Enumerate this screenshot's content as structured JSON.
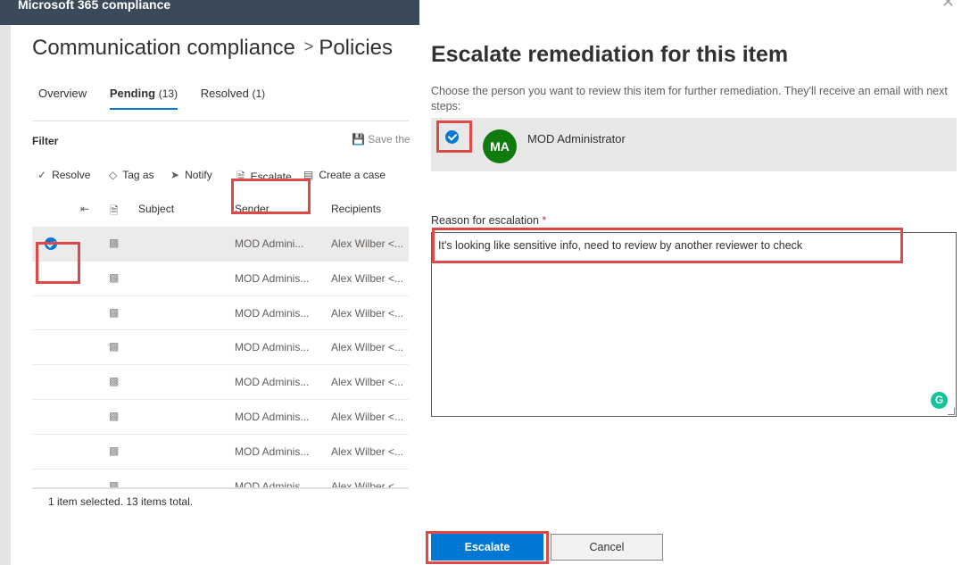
{
  "app": {
    "title": "Microsoft 365 compliance"
  },
  "breadcrumb": {
    "parent": "Communication compliance",
    "separator": ">",
    "current": "Policies"
  },
  "tabs": [
    {
      "label": "Overview",
      "count": ""
    },
    {
      "label": "Pending",
      "count": "(13)",
      "active": true
    },
    {
      "label": "Resolved",
      "count": "(1)"
    }
  ],
  "filter": {
    "label": "Filter",
    "save_label": "Save the"
  },
  "commands": {
    "resolve": "Resolve",
    "tag_as": "Tag as",
    "notify": "Notify",
    "escalate": "Escalate",
    "create_case": "Create a case"
  },
  "grid": {
    "columns": {
      "subject": "Subject",
      "sender": "Sender",
      "recipients": "Recipients"
    },
    "rows": [
      {
        "sender": "MOD Admini...",
        "recipients": "Alex Wilber <...",
        "selected": true
      },
      {
        "sender": "MOD Adminis...",
        "recipients": "Alex Wilber <..."
      },
      {
        "sender": "MOD Adminis...",
        "recipients": "Alex Wilber <..."
      },
      {
        "sender": "MOD Adminis...",
        "recipients": "Alex Wilber <..."
      },
      {
        "sender": "MOD Adminis...",
        "recipients": "Alex Wilber <..."
      },
      {
        "sender": "MOD Adminis...",
        "recipients": "Alex Wilber <..."
      },
      {
        "sender": "MOD Adminis...",
        "recipients": "Alex Wilber <..."
      },
      {
        "sender": "MOD Adminis...",
        "recipients": "Alex Wilber <..."
      }
    ],
    "footer": "1 item selected.  13 items total."
  },
  "panel": {
    "title": "Escalate remediation for this item",
    "description": "Choose the person you want to review this item for further remediation. They'll receive an email with next steps:",
    "person": {
      "initials": "MA",
      "name": "MOD Administrator",
      "avatar_color": "#107c10",
      "checked": true
    },
    "reason_label": "Reason for escalation",
    "required_marker": "*",
    "reason_text": "It's looking like sensitive info, need to review by another reviewer to check",
    "escalate_button": "Escalate",
    "cancel_button": "Cancel"
  },
  "colors": {
    "accent": "#0078d4",
    "highlight": "#e04848",
    "topbar": "#3b4a5a"
  }
}
